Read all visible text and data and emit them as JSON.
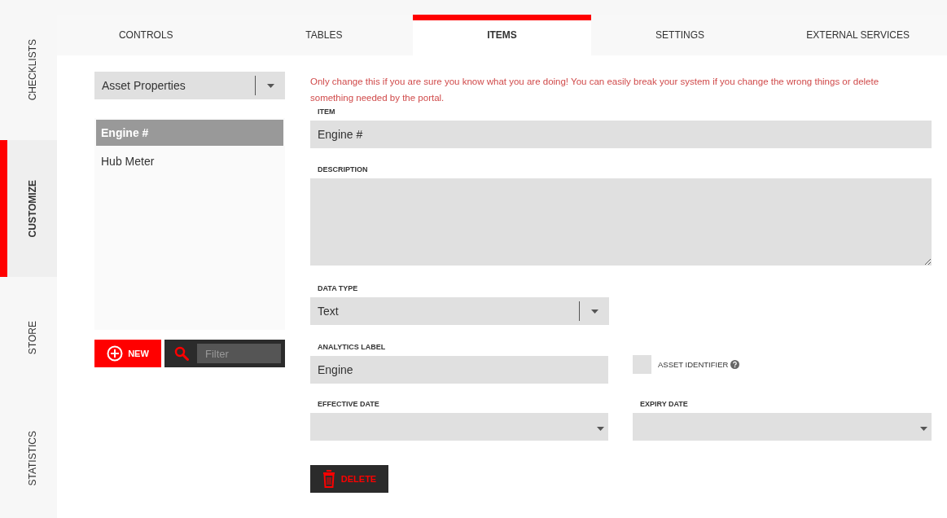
{
  "sidebar": {
    "items": [
      {
        "label": "CHECKLISTS",
        "selected": false
      },
      {
        "label": "CUSTOMIZE",
        "selected": true
      },
      {
        "label": "STORE",
        "selected": false
      },
      {
        "label": "STATISTICS",
        "selected": false
      }
    ]
  },
  "tabs": [
    {
      "label": "CONTROLS",
      "selected": false
    },
    {
      "label": "TABLES",
      "selected": false
    },
    {
      "label": "ITEMS",
      "selected": true
    },
    {
      "label": "SETTINGS",
      "selected": false
    },
    {
      "label": "EXTERNAL SERVICES",
      "selected": false
    }
  ],
  "list_panel": {
    "category_select": {
      "value": "Asset Properties"
    },
    "items": [
      {
        "label": "Engine #",
        "selected": true
      },
      {
        "label": "Hub Meter",
        "selected": false
      }
    ],
    "new_button": "NEW",
    "filter": {
      "placeholder": "Filter"
    }
  },
  "form": {
    "warning": "Only change this if you are sure you know what you are doing! You can easily break your system if you change the wrong things or delete something needed by the portal.",
    "item": {
      "label": "ITEM",
      "value": "Engine #"
    },
    "description": {
      "label": "DESCRIPTION"
    },
    "data_type": {
      "label": "DATA TYPE",
      "value": "Text"
    },
    "analytics_label": {
      "label": "ANALYTICS LABEL",
      "value": "Engine"
    },
    "asset_identifier": {
      "label": "ASSET IDENTIFIER",
      "checked": false
    },
    "effective_date": {
      "label": "EFFECTIVE DATE"
    },
    "expiry_date": {
      "label": "EXPIRY DATE"
    },
    "delete_button": "DELETE"
  }
}
